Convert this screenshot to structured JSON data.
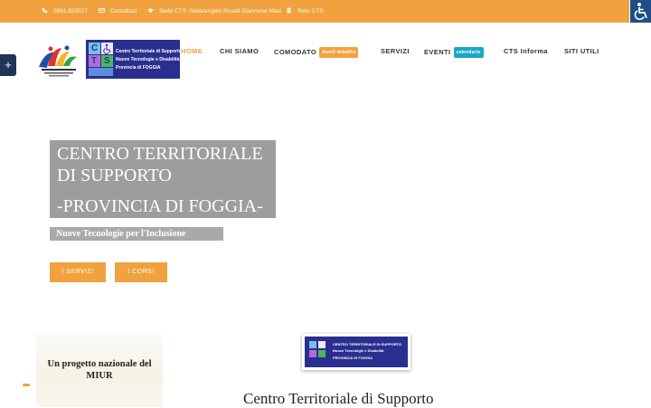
{
  "colors": {
    "accent": "#f0a23e",
    "logo_blue": "#2a2f8f",
    "hero_box": "#9d9d9d",
    "access_blue": "#1f4e86"
  },
  "topbar": {
    "phone": "0881.633517",
    "contact": "Contattaci",
    "sede": "Sede CTS -Notarangelo Rosati Giannone Masi",
    "rete": "Rete CTS",
    "icons": [
      "phone-icon",
      "envelope-icon",
      "graduation-cap-icon",
      "building-icon"
    ]
  },
  "logo": {
    "line1": "Centro Territoriale di Supporto",
    "line2": "Nuove Tecnologie e Disabilità",
    "line3": "Provincia di FOGGIA",
    "letters": [
      "C",
      "T",
      "S"
    ]
  },
  "nav": {
    "home": "HOME",
    "chi_siamo": "CHI SIAMO",
    "comodato": "COMODATO",
    "comodato_badge": "Ausili didattici",
    "servizi": "SERVIZI",
    "eventi": "EVENTI",
    "eventi_badge": "calendario",
    "cts_informa": "CTS Informa",
    "siti_utili": "SITI UTILI"
  },
  "side_toggle": "+",
  "hero": {
    "line1": "CENTRO TERRITORIALE",
    "line2": "DI SUPPORTO",
    "line3": "-PROVINCIA DI FOGGIA-",
    "subtitle": "Nuove Tecnologie per l'Inclusione",
    "btn_servizi": "I SERVIZI",
    "btn_corsi": "I CORSI"
  },
  "card": {
    "line1": "Un progetto nazionale del",
    "line2": "MIUR"
  },
  "small_logo": {
    "line1": "CENTRO TERRITORIALE DI SUPPORTO",
    "line2": "Nuove Tecnologie e Disabilità",
    "line3": "PROVINCIA DI FOGGIA"
  },
  "section": {
    "title": "Centro Territoriale di Supporto"
  }
}
